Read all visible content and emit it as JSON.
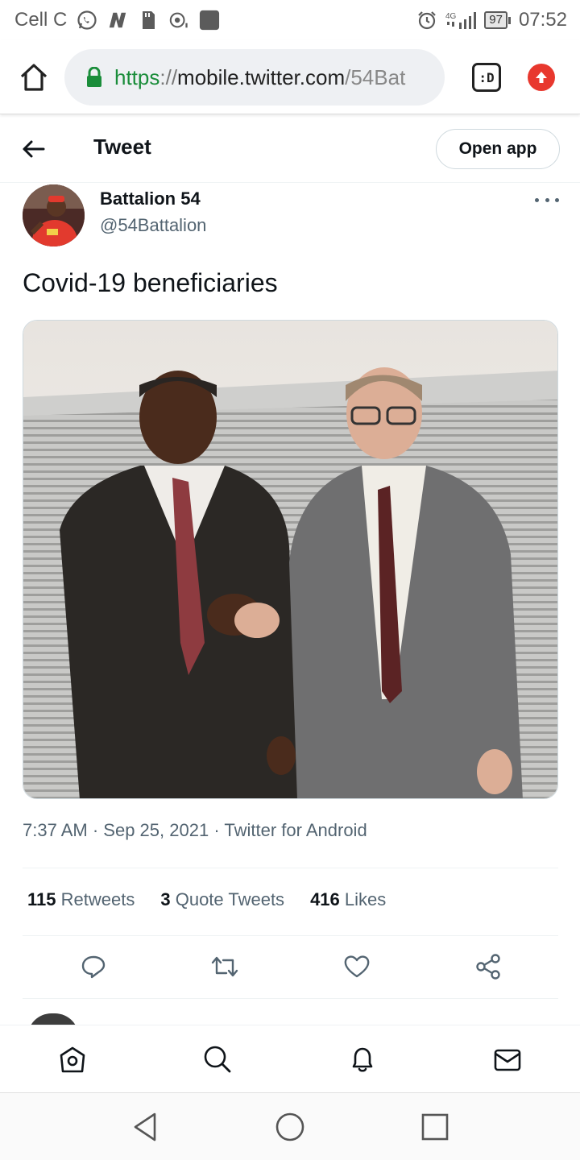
{
  "status_bar": {
    "carrier": "Cell C",
    "network": "4G",
    "battery": "97",
    "time": "07:52",
    "left_icons": [
      "whatsapp-icon",
      "news-icon",
      "sd-card-icon",
      "camera-icon",
      "app-icon"
    ],
    "right_icons": [
      "alarm-icon",
      "signal-icon",
      "battery-icon"
    ]
  },
  "browser": {
    "url_scheme": "https",
    "url_sep": "://",
    "url_host": "mobile.twitter.com",
    "url_path": "/54Bat",
    "tabs_label": ":D"
  },
  "header": {
    "title": "Tweet",
    "open_app": "Open app"
  },
  "tweet": {
    "author_name": "Battalion 54",
    "author_handle": "@54Battalion",
    "text": "Covid-19 beneficiaries",
    "time": "7:37 AM",
    "date": "Sep 25, 2021",
    "source": "Twitter for Android",
    "separator": "·"
  },
  "stats": {
    "retweets_count": "115",
    "retweets_label": "Retweets",
    "quotes_count": "3",
    "quotes_label": "Quote Tweets",
    "likes_count": "416",
    "likes_label": "Likes"
  },
  "colors": {
    "url_green": "#1a8d3a",
    "update_red": "#e8382e",
    "secondary_text": "#536471"
  }
}
